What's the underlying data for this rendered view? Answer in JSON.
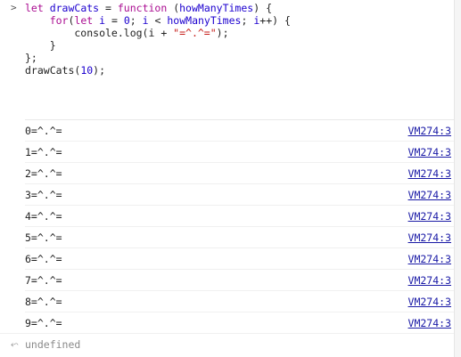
{
  "input": {
    "prompt_icon": "chevron-right-icon",
    "code_lines": [
      [
        {
          "t": "kw",
          "v": "let "
        },
        {
          "t": "var",
          "v": "drawCats"
        },
        {
          "t": "plain",
          "v": " = "
        },
        {
          "t": "kw",
          "v": "function"
        },
        {
          "t": "plain",
          "v": " ("
        },
        {
          "t": "param",
          "v": "howManyTimes"
        },
        {
          "t": "plain",
          "v": ") {"
        }
      ],
      [
        {
          "t": "plain",
          "v": "    "
        },
        {
          "t": "kw",
          "v": "for"
        },
        {
          "t": "plain",
          "v": "("
        },
        {
          "t": "kw",
          "v": "let"
        },
        {
          "t": "plain",
          "v": " "
        },
        {
          "t": "var",
          "v": "i"
        },
        {
          "t": "plain",
          "v": " = "
        },
        {
          "t": "num",
          "v": "0"
        },
        {
          "t": "plain",
          "v": "; "
        },
        {
          "t": "var",
          "v": "i"
        },
        {
          "t": "plain",
          "v": " < "
        },
        {
          "t": "var",
          "v": "howManyTimes"
        },
        {
          "t": "plain",
          "v": "; "
        },
        {
          "t": "var",
          "v": "i"
        },
        {
          "t": "plain",
          "v": "++) {"
        }
      ],
      [
        {
          "t": "plain",
          "v": "        console.log(i + "
        },
        {
          "t": "str",
          "v": "\"=^.^=\""
        },
        {
          "t": "plain",
          "v": ");"
        }
      ],
      [
        {
          "t": "plain",
          "v": "    }"
        }
      ],
      [
        {
          "t": "plain",
          "v": "};"
        }
      ],
      [
        {
          "t": "plain",
          "v": "drawCats("
        },
        {
          "t": "num",
          "v": "10"
        },
        {
          "t": "plain",
          "v": ");"
        }
      ]
    ]
  },
  "logs": [
    {
      "text": "0=^.^=",
      "source": "VM274:3"
    },
    {
      "text": "1=^.^=",
      "source": "VM274:3"
    },
    {
      "text": "2=^.^=",
      "source": "VM274:3"
    },
    {
      "text": "3=^.^=",
      "source": "VM274:3"
    },
    {
      "text": "4=^.^=",
      "source": "VM274:3"
    },
    {
      "text": "5=^.^=",
      "source": "VM274:3"
    },
    {
      "text": "6=^.^=",
      "source": "VM274:3"
    },
    {
      "text": "7=^.^=",
      "source": "VM274:3"
    },
    {
      "text": "8=^.^=",
      "source": "VM274:3"
    },
    {
      "text": "9=^.^=",
      "source": "VM274:3"
    }
  ],
  "result": {
    "icon": "return-arrow-icon",
    "text": "undefined"
  }
}
